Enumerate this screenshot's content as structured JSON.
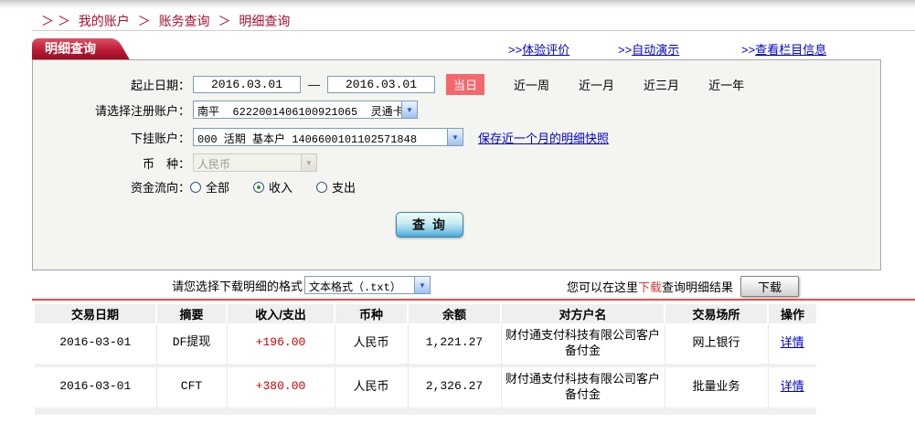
{
  "colors": {
    "accent_red": "#b11430",
    "badge_red": "#f4686c",
    "rule_red": "#ee4a44",
    "link_blue": "#0000cc",
    "hint_red": "#e4393c",
    "amount_red": "#cc0000"
  },
  "breadcrumb": {
    "prefix": "＞ ＞",
    "sep": "＞",
    "items": [
      "我的账户",
      "账务查询",
      "明细查询"
    ]
  },
  "tab": {
    "title": "明细查询"
  },
  "top_links": [
    {
      "prefix": ">>",
      "label": "体验评价"
    },
    {
      "prefix": ">>",
      "label": "自动演示"
    },
    {
      "prefix": ">>",
      "label": "查看栏目信息"
    }
  ],
  "form": {
    "date_row": {
      "label": "起止日期：",
      "start_value": "2016.03.01",
      "separator": "—",
      "end_value": "2016.03.01",
      "quick_ranges": [
        {
          "label": "当日",
          "active": true
        },
        {
          "label": "近一周",
          "active": false
        },
        {
          "label": "近一月",
          "active": false
        },
        {
          "label": "近三月",
          "active": false
        },
        {
          "label": "近一年",
          "active": false
        }
      ]
    },
    "registered_account": {
      "label": "请选择注册账户：",
      "value": "南平  6222001406100921065  灵通卡"
    },
    "sub_account": {
      "label": "下挂账户：",
      "value": "000 活期 基本户 1406600101102571848",
      "snapshot_link": "保存近一个月的明细快照"
    },
    "currency": {
      "label": "币　种：",
      "value": "人民币",
      "disabled": true
    },
    "flow": {
      "label": "资金流向：",
      "options": [
        {
          "label": "全部",
          "checked": false
        },
        {
          "label": "收入",
          "checked": true
        },
        {
          "label": "支出",
          "checked": false
        }
      ]
    },
    "query_button": "查 询"
  },
  "download": {
    "format_label": "请您选择下载明细的格式",
    "format_value": "文本格式（.txt）",
    "hint_prefix": "您可以在这里",
    "hint_highlight": "下载",
    "hint_suffix": "查询明细结果",
    "button_label": "下载"
  },
  "table": {
    "headers": [
      "交易日期",
      "摘要",
      "收入/支出",
      "币种",
      "余额",
      "对方户名",
      "交易场所",
      "操作"
    ],
    "rows": [
      {
        "date": "2016-03-01",
        "summary": "DF提现",
        "amount": "+196.00",
        "currency": "人民币",
        "balance": "1,221.27",
        "counterparty": "财付通支付科技有限公司客户备付金",
        "channel": "网上银行",
        "action": "详情"
      },
      {
        "date": "2016-03-01",
        "summary": "CFT",
        "amount": "+380.00",
        "currency": "人民币",
        "balance": "2,326.27",
        "counterparty": "财付通支付科技有限公司客户备付金",
        "channel": "批量业务",
        "action": "详情"
      }
    ]
  }
}
